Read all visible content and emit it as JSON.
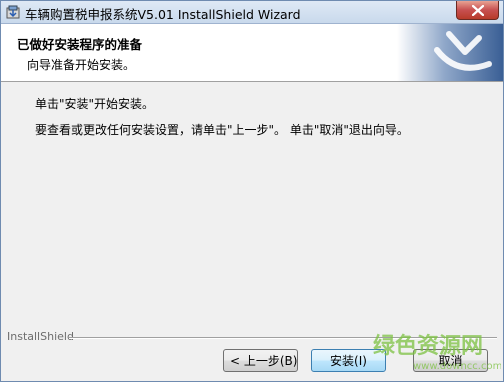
{
  "window": {
    "title": "车辆购置税申报系统V5.01 InstallShield Wizard",
    "close_icon": "close-icon",
    "app_icon": "installer-icon"
  },
  "header": {
    "title": "已做好安装程序的准备",
    "subtitle": "向导准备开始安装。",
    "logo_icon": "installshield-logo-icon"
  },
  "body": {
    "line1": "单击\"安装\"开始安装。",
    "line2": "要查看或更改任何安装设置，请单击\"上一步\"。 单击\"取消\"退出向导。"
  },
  "footer": {
    "brand": "InstallShield",
    "buttons": {
      "back": "< 上一步(B)",
      "install": "安装(I)",
      "cancel": "取消"
    }
  },
  "watermark": {
    "text": "绿色资源网",
    "url": "www.downcc.com"
  },
  "colors": {
    "window_bg": "#f0f0f0",
    "banner_bg": "#ffffff",
    "logo_blue": "#3a5f95",
    "watermark_green": "#7dc242"
  }
}
